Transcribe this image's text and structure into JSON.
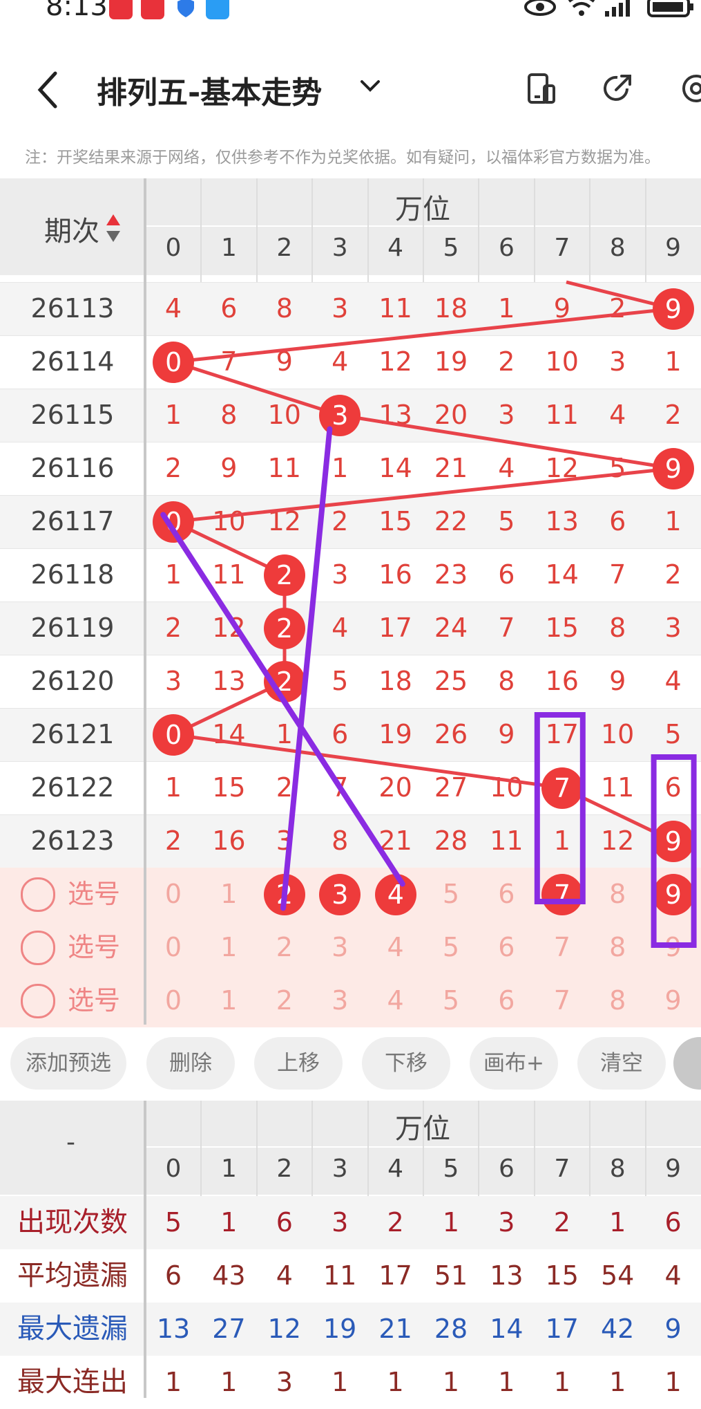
{
  "status_bar": {
    "time": "8:13"
  },
  "header": {
    "title": "排列五-基本走势"
  },
  "notice": "注：开奖结果来源于网络，仅供参考不作为兑奖依据。如有疑问，以福体彩官方数据为准。",
  "table": {
    "period_header": "期次",
    "section_header": "万位",
    "digits": [
      "0",
      "1",
      "2",
      "3",
      "4",
      "5",
      "6",
      "7",
      "8",
      "9"
    ],
    "rows": [
      {
        "period": "26113",
        "cells": [
          "4",
          "6",
          "8",
          "3",
          "11",
          "18",
          "1",
          "9",
          "2",
          "9"
        ],
        "hit": 9
      },
      {
        "period": "26114",
        "cells": [
          "0",
          "7",
          "9",
          "4",
          "12",
          "19",
          "2",
          "10",
          "3",
          "1"
        ],
        "hit": 0
      },
      {
        "period": "26115",
        "cells": [
          "1",
          "8",
          "10",
          "3",
          "13",
          "20",
          "3",
          "11",
          "4",
          "2"
        ],
        "hit": 3
      },
      {
        "period": "26116",
        "cells": [
          "2",
          "9",
          "11",
          "1",
          "14",
          "21",
          "4",
          "12",
          "5",
          "9"
        ],
        "hit": 9
      },
      {
        "period": "26117",
        "cells": [
          "0",
          "10",
          "12",
          "2",
          "15",
          "22",
          "5",
          "13",
          "6",
          "1"
        ],
        "hit": 0
      },
      {
        "period": "26118",
        "cells": [
          "1",
          "11",
          "2",
          "3",
          "16",
          "23",
          "6",
          "14",
          "7",
          "2"
        ],
        "hit": 2
      },
      {
        "period": "26119",
        "cells": [
          "2",
          "12",
          "2",
          "4",
          "17",
          "24",
          "7",
          "15",
          "8",
          "3"
        ],
        "hit": 2
      },
      {
        "period": "26120",
        "cells": [
          "3",
          "13",
          "2",
          "5",
          "18",
          "25",
          "8",
          "16",
          "9",
          "4"
        ],
        "hit": 2
      },
      {
        "period": "26121",
        "cells": [
          "0",
          "14",
          "1",
          "6",
          "19",
          "26",
          "9",
          "17",
          "10",
          "5"
        ],
        "hit": 0
      },
      {
        "period": "26122",
        "cells": [
          "1",
          "15",
          "2",
          "7",
          "20",
          "27",
          "10",
          "7",
          "11",
          "6"
        ],
        "hit": 7
      },
      {
        "period": "26123",
        "cells": [
          "2",
          "16",
          "3",
          "8",
          "21",
          "28",
          "11",
          "1",
          "12",
          "9"
        ],
        "hit": 9
      }
    ],
    "select_label": "选号",
    "select_rows": [
      {
        "cells": [
          "0",
          "1",
          "2",
          "3",
          "4",
          "5",
          "6",
          "7",
          "8",
          "9"
        ],
        "selected": [
          2,
          3,
          4,
          7,
          9
        ]
      },
      {
        "cells": [
          "0",
          "1",
          "2",
          "3",
          "4",
          "5",
          "6",
          "7",
          "8",
          "9"
        ],
        "selected": []
      },
      {
        "cells": [
          "0",
          "1",
          "2",
          "3",
          "4",
          "5",
          "6",
          "7",
          "8",
          "9"
        ],
        "selected": []
      }
    ]
  },
  "buttons": [
    "添加预选",
    "删除",
    "上移",
    "下移",
    "画布+",
    "清空"
  ],
  "stats": {
    "corner": "-",
    "section_header": "万位",
    "digits": [
      "0",
      "1",
      "2",
      "3",
      "4",
      "5",
      "6",
      "7",
      "8",
      "9"
    ],
    "rows": [
      {
        "label": "出现次数",
        "color": "#a81f2a",
        "values": [
          "5",
          "1",
          "6",
          "3",
          "2",
          "1",
          "3",
          "2",
          "1",
          "6"
        ]
      },
      {
        "label": "平均遗漏",
        "color": "#8b2a25",
        "values": [
          "6",
          "43",
          "4",
          "11",
          "17",
          "51",
          "13",
          "15",
          "54",
          "4"
        ]
      },
      {
        "label": "最大遗漏",
        "color": "#2a5ab8",
        "values": [
          "13",
          "27",
          "12",
          "19",
          "21",
          "28",
          "14",
          "17",
          "42",
          "9"
        ]
      },
      {
        "label": "最大连出",
        "color": "#8b2a25",
        "values": [
          "1",
          "1",
          "3",
          "1",
          "1",
          "1",
          "1",
          "1",
          "1",
          "1"
        ]
      }
    ]
  },
  "colors": {
    "accent": "#ee3b3b",
    "annotation": "#8a2be2",
    "text_red": "#e0413a"
  }
}
